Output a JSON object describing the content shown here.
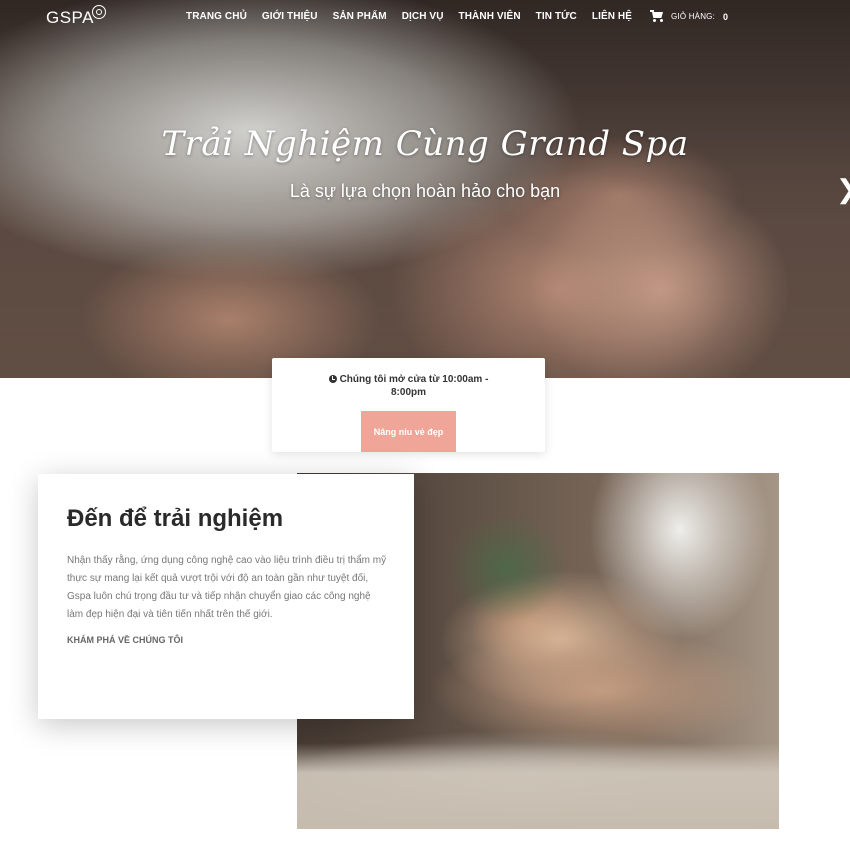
{
  "header": {
    "logo": "GSPA",
    "logo_icon": "rose-icon",
    "nav": [
      {
        "label": "TRANG CHỦ"
      },
      {
        "label": "GIỚI THIỆU"
      },
      {
        "label": "SẢN PHẨM"
      },
      {
        "label": "DỊCH VỤ"
      },
      {
        "label": "THÀNH VIÊN"
      },
      {
        "label": "TIN TỨC"
      },
      {
        "label": "LIÊN HỆ"
      }
    ],
    "cart": {
      "label": "GIỎ HÀNG:",
      "count": "0",
      "icon": "cart-icon"
    }
  },
  "hero": {
    "title": "Trải Nghiệm Cùng Grand Spa",
    "subtitle": "Là sự lựa chọn hoàn hảo cho bạn",
    "next_icon": "chevron-right-icon",
    "next_glyph": "❯"
  },
  "hours": {
    "icon": "clock-icon",
    "text": "Chúng tôi mở cửa từ 10:00am - 8:00pm",
    "button_label": "Nâng niu vẻ đẹp",
    "button_color": "#efa597"
  },
  "feature": {
    "title": "Đến để trải nghiệm",
    "body": "Nhận thấy rằng, ứng dụng công nghệ cao vào liệu trình điều trị thẩm mỹ thực sự mang lại kết quả vượt trội với độ an toàn gần như tuyệt đối, Gspa luôn chú trọng đầu tư và tiếp nhận chuyển giao các công nghệ làm đẹp hiện đại và tiên tiến nhất trên thế giới.",
    "link_label": "KHÁM PHÁ VỀ CHÚNG TÔI"
  }
}
